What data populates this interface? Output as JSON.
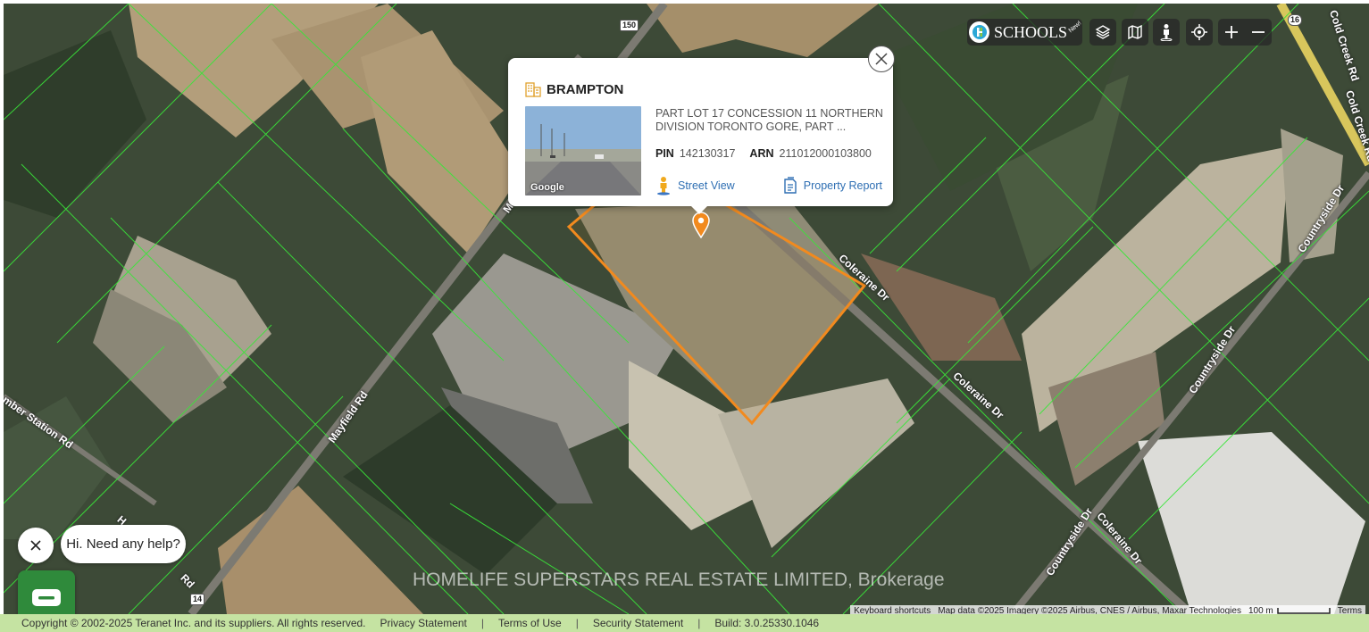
{
  "popup": {
    "city": "BRAMPTON",
    "description": "PART LOT 17 CONCESSION 11 NORTHERN DIVISION TORONTO GORE, PART ...",
    "pin_label": "PIN",
    "pin_value": "142130317",
    "arn_label": "ARN",
    "arn_value": "211012000103800",
    "street_view_label": "Street View",
    "property_report_label": "Property Report",
    "thumbnail_caption": "Google"
  },
  "toolbar": {
    "schools_label": "SCHOOLS",
    "schools_badge": "New!"
  },
  "map": {
    "roads": {
      "mayfield": "Mayfield Rd",
      "coleraine_1": "Coleraine Dr",
      "coleraine_2": "Coleraine Dr",
      "coleraine_3": "Coleraine Dr",
      "countryside_1": "Countryside Dr",
      "countryside_2": "Countryside Dr",
      "countryside_3": "Countryside Dr",
      "cold_creek_1": "Cold Creek Rd",
      "cold_creek_2": "Cold Creek Rd",
      "humber_station": "mber Station Rd",
      "humber_2": "H",
      "humber_2b": "Rd",
      "m_partial": "M"
    },
    "shields": {
      "hwy_150": "150",
      "hwy_16": "16",
      "hwy_14": "14"
    },
    "watermark": "HOMELIFE SUPERSTARS REAL ESTATE LIMITED, Brokerage",
    "attribution": {
      "keyboard": "Keyboard shortcuts",
      "data": "Map data ©2025 Imagery ©2025 Airbus, CNES / Airbus, Maxar Technologies",
      "scale": "100 m",
      "terms": "Terms"
    },
    "colors": {
      "parcel_lines": "#39e639",
      "selected_parcel": "#f28a1e",
      "marker": "#f28a1e"
    }
  },
  "chat": {
    "greeting": "Hi. Need any help?"
  },
  "footer": {
    "copyright": "Copyright © 2002-2025 Teranet Inc. and its suppliers. All rights reserved.",
    "privacy": "Privacy Statement",
    "terms": "Terms of Use",
    "security": "Security Statement",
    "build": "Build: 3.0.25330.1046",
    "separator": "|"
  }
}
